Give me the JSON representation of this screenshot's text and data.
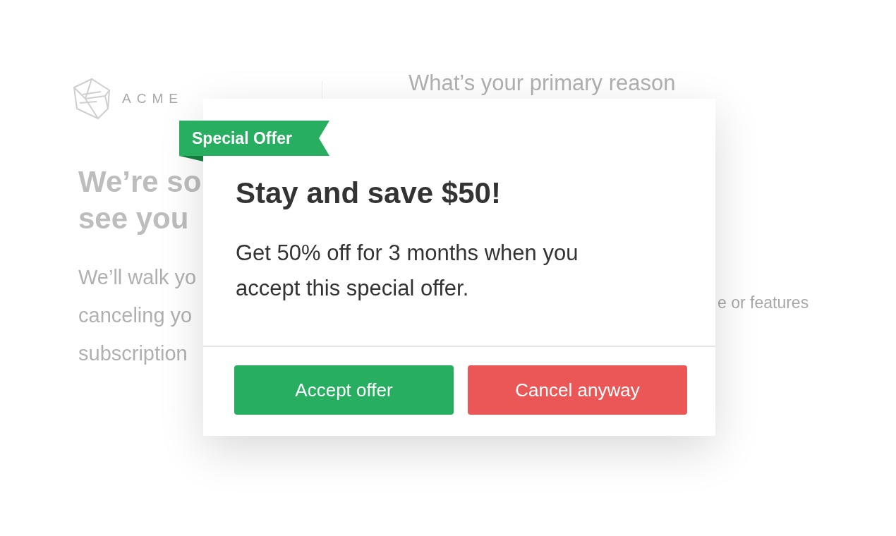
{
  "background": {
    "logo_text": "ACME",
    "heading_lines": [
      "We’re so",
      "see you"
    ],
    "intro_lines": [
      "We’ll walk yo",
      "canceling yo",
      "subscription"
    ],
    "question": "What’s your primary reason",
    "option_fragment": "e or features"
  },
  "modal": {
    "ribbon": "Special Offer",
    "title": "Stay and save $50!",
    "body": "Get 50% off for 3 months when you accept this special offer.",
    "buttons": [
      {
        "label": "Accept offer",
        "kind": "accept"
      },
      {
        "label": "Cancel anyway",
        "kind": "cancel"
      }
    ]
  }
}
